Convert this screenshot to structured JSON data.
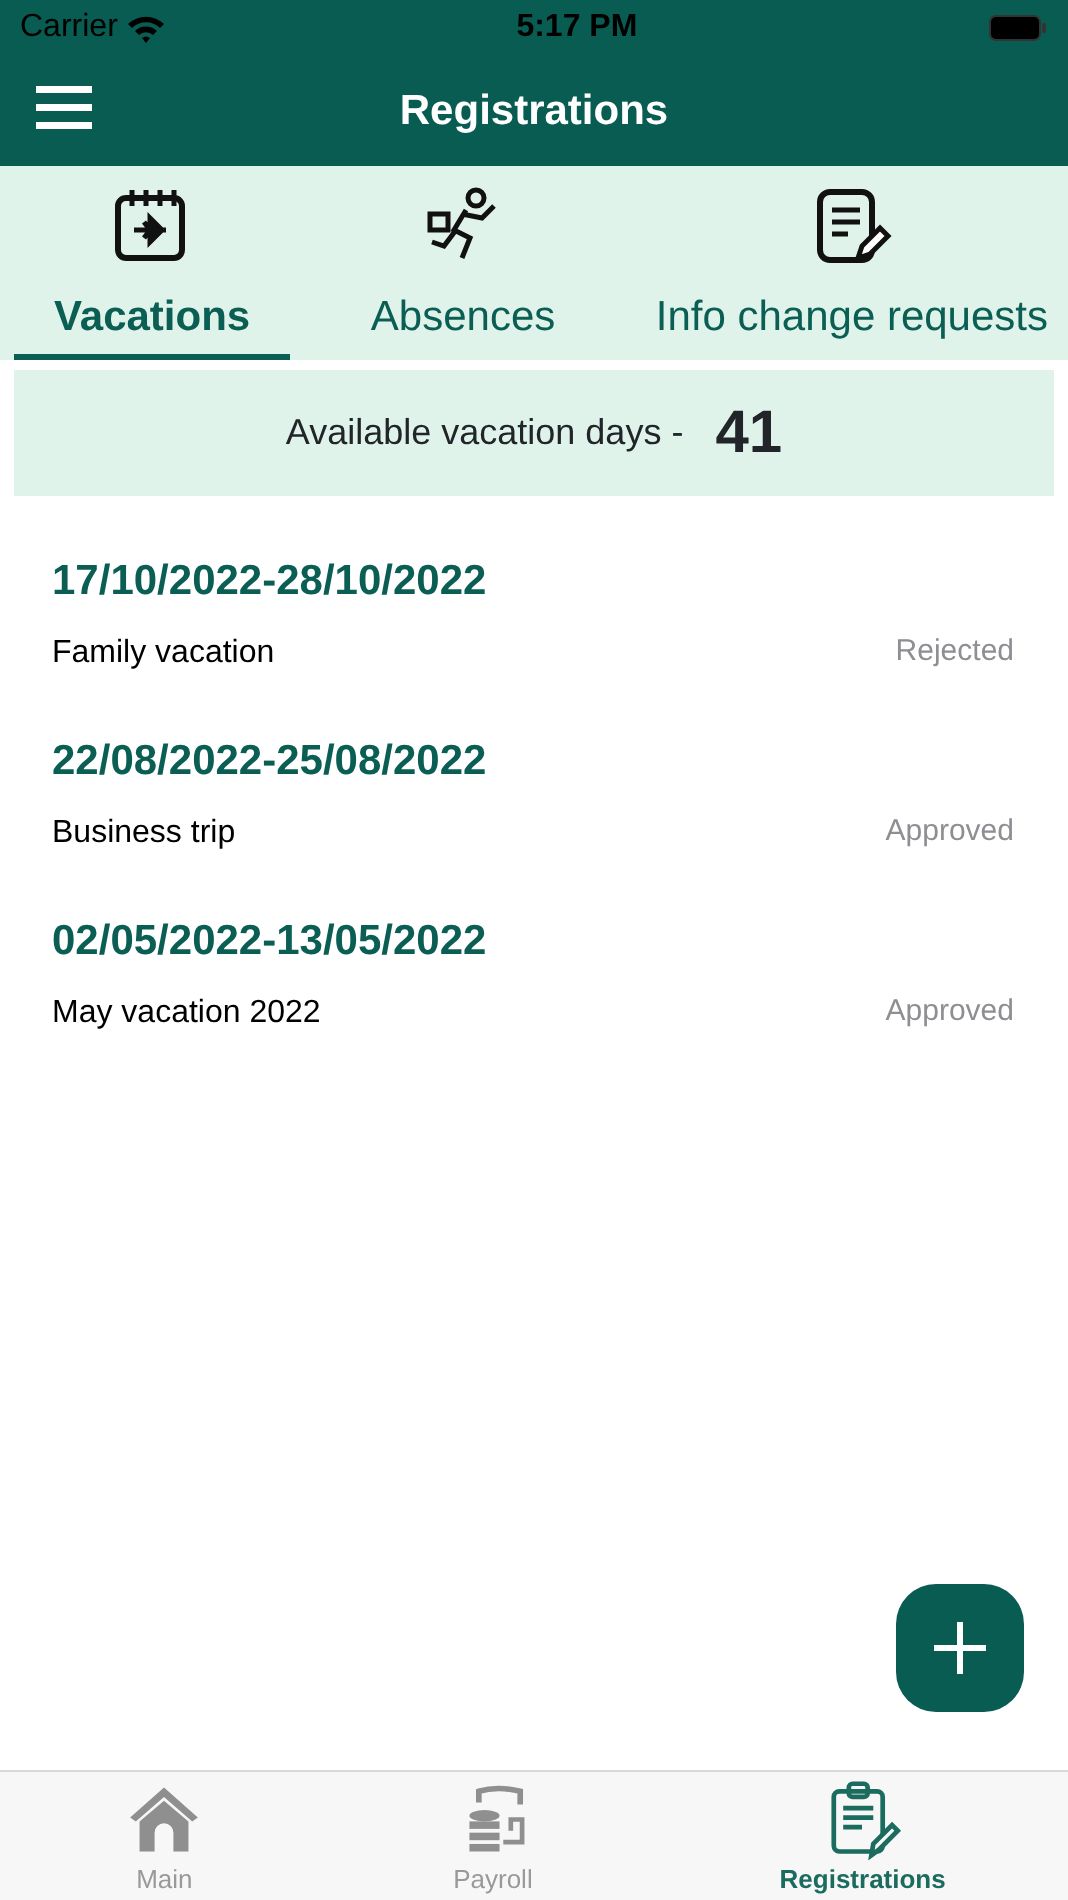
{
  "status_bar": {
    "carrier": "Carrier",
    "time": "5:17 PM"
  },
  "header": {
    "title": "Registrations"
  },
  "tabs": [
    {
      "label": "Vacations",
      "kind": "calendar",
      "selected": true
    },
    {
      "label": "Absences",
      "kind": "runner",
      "selected": false
    },
    {
      "label": "Info change requests",
      "kind": "document",
      "selected": false
    }
  ],
  "summary": {
    "label": "Available vacation days -",
    "value": "41"
  },
  "registrations": [
    {
      "dates": "17/10/2022-28/10/2022",
      "title": "Family vacation",
      "status": "Rejected"
    },
    {
      "dates": "22/08/2022-25/08/2022",
      "title": "Business trip",
      "status": "Approved"
    },
    {
      "dates": "02/05/2022-13/05/2022",
      "title": "May vacation 2022",
      "status": "Approved"
    }
  ],
  "bottom_nav": [
    {
      "label": "Main",
      "kind": "home",
      "selected": false
    },
    {
      "label": "Payroll",
      "kind": "payroll",
      "selected": false
    },
    {
      "label": "Registrations",
      "kind": "clipboard",
      "selected": true
    }
  ]
}
